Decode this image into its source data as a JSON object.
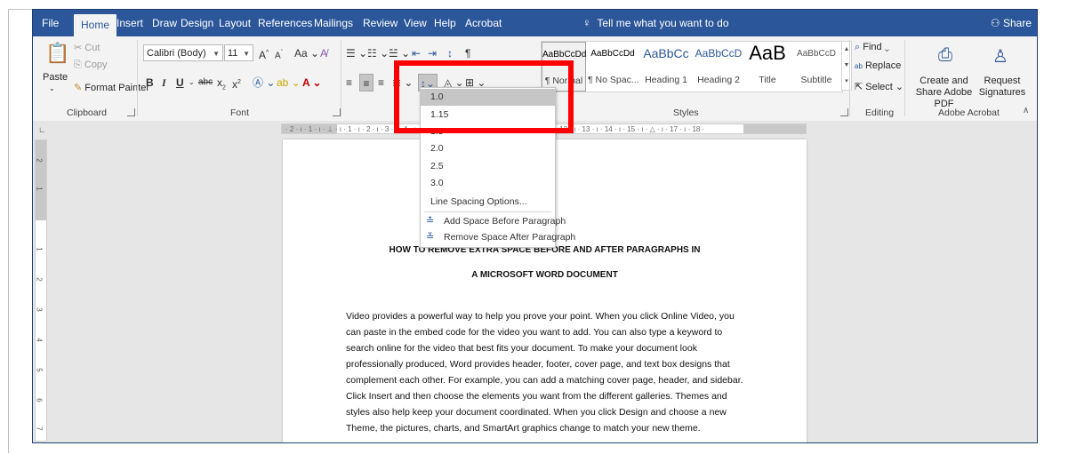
{
  "menubar": {
    "tabs": [
      "File",
      "Home",
      "Insert",
      "Draw",
      "Design",
      "Layout",
      "References",
      "Mailings",
      "Review",
      "View",
      "Help",
      "Acrobat"
    ],
    "tell_me": "Tell me what you want to do",
    "share": "Share"
  },
  "clipboard": {
    "paste": "Paste",
    "cut": "Cut",
    "copy": "Copy",
    "format_painter": "Format Painter",
    "label": "Clipboard"
  },
  "font": {
    "name": "Calibri (Body)",
    "size": "11",
    "label": "Font"
  },
  "paragraph": {
    "label": "Pa"
  },
  "styles": {
    "label": "Styles",
    "items": [
      {
        "sample": "AaBbCcDd",
        "name": "¶ Normal"
      },
      {
        "sample": "AaBbCcDd",
        "name": "¶ No Spac..."
      },
      {
        "sample": "AaBbCc",
        "name": "Heading 1"
      },
      {
        "sample": "AaBbCcD",
        "name": "Heading 2"
      },
      {
        "sample": "AaB",
        "name": "Title"
      },
      {
        "sample": "AaBbCcD",
        "name": "Subtitle"
      }
    ]
  },
  "editing": {
    "find": "Find",
    "replace": "Replace",
    "select": "Select",
    "label": "Editing"
  },
  "acrobat": {
    "create": "Create and Share Adobe PDF",
    "request": "Request Signatures",
    "label": "Adobe Acrobat"
  },
  "ruler": {
    "h": "· 2 · ı · 1 · ı · ⊥ · ı · 1 · ı · 2 · ı · 3 · ı · 4 · ı · 5 · ı · 6 · ı · 7 · ı · 8 · ı · 9 · ı · 10 · ı · 11 · ı · 12 · ı · 13 · ı · 14 · ı · 15 · ı · △ · ı · 17 · ı · 18 ·",
    "v": [
      "2",
      "1",
      "1",
      "2",
      "3",
      "4",
      "5",
      "6",
      "7"
    ]
  },
  "line_spacing_menu": {
    "values": [
      "1.0",
      "1.15",
      "1.5",
      "2.0",
      "2.5",
      "3.0"
    ],
    "options": "Line Spacing Options...",
    "add_before": "Add Space Before Paragraph",
    "remove_after": "Remove Space After Paragraph"
  },
  "document": {
    "title_line1": "HOW TO REMOVE EXTRA SPACE BEFORE AND AFTER PARAGRAPHS IN",
    "title_line2": "A MICROSOFT WORD DOCUMENT",
    "body": "Video provides a powerful way to help you prove your point. When you click Online Video, you can paste in the embed code for the video you want to add. You can also type a keyword to search online for the video that best fits your document. To make your document look professionally produced, Word provides header, footer, cover page, and text box designs that complement each other. For example, you can add a matching cover page, header, and sidebar. Click Insert and then choose the elements you want from the different galleries. Themes and styles also help keep your document coordinated. When you click Design and choose a new Theme, the pictures, charts, and SmartArt graphics change to match your new theme."
  },
  "colors": {
    "brand": "#2b579a",
    "highlight": "#ff0000"
  }
}
